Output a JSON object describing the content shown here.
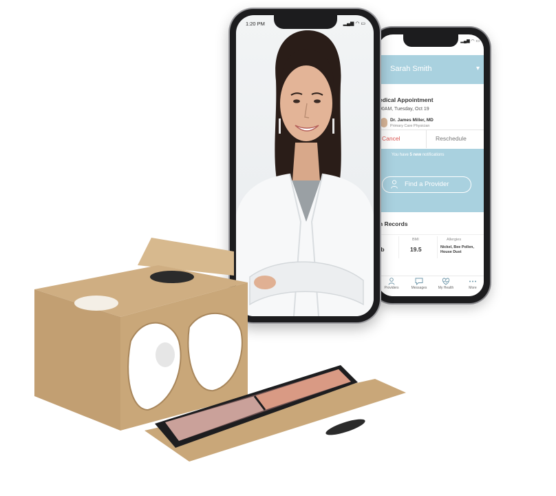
{
  "front_phone": {
    "status_time": "1:20 PM",
    "status_icons": "▂▄▆ ◠ ▭",
    "video_subject": "doctor-video-call"
  },
  "back_phone": {
    "status_icons": "▂▄▆ ◠ ▭",
    "user_name": "Sarah Smith",
    "appointment": {
      "title": "Medical Appointment",
      "title_visible": "edical Appointment",
      "time": "00AM, Tuesday, Oct 19",
      "doctor_name": "Dr. James Miller, MD",
      "doctor_role": "Primary Care Physician",
      "cancel_label": "Cancel",
      "reschedule_label": "Reschedule"
    },
    "notification": {
      "prefix": "You have ",
      "count": "5 new",
      "suffix": " notifications"
    },
    "find_provider_label": "Find a Provider",
    "records": {
      "title": "h Records",
      "first_label": "t",
      "first_value": "lb",
      "bmi_label": "BMI",
      "bmi_value": "19.5",
      "allergies_label": "Allergies",
      "allergies_line1": "Nickel, Bee Pollen,",
      "allergies_line2": "House Dust"
    },
    "tabs": [
      {
        "label": "Providers"
      },
      {
        "label": "Messages"
      },
      {
        "label": "My Health"
      },
      {
        "label": "More"
      }
    ]
  },
  "colors": {
    "app_accent": "#a9d1df",
    "cancel": "#d9534f",
    "cardboard": "#c9a779"
  }
}
